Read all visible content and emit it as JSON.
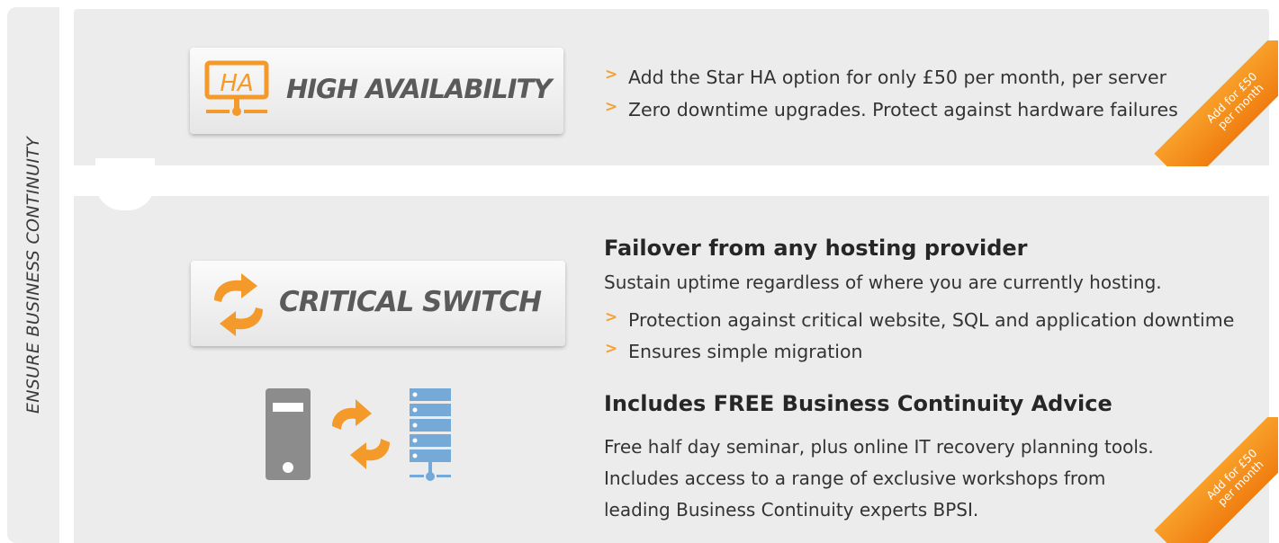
{
  "sidebar": {
    "label": "ENSURE BUSINESS CONTINUITY"
  },
  "ha": {
    "title": "HIGH AVAILABILITY",
    "icon_text": "HA",
    "bullets": [
      "Add the Star HA option for only £50 per month, per server",
      "Zero downtime upgrades. Protect against hardware failures"
    ],
    "ribbon_line1": "Add for £50",
    "ribbon_line2": "per month"
  },
  "critical": {
    "title": "CRITICAL SWITCH",
    "heading": "Failover from any hosting provider",
    "intro": "Sustain uptime regardless of where you are currently hosting.",
    "bullets": [
      "Protection against critical website, SQL and application downtime",
      "Ensures simple migration"
    ],
    "advice_heading": "Includes FREE Business Continuity Advice",
    "advice_lines": [
      "Free half day seminar, plus online IT recovery planning tools.",
      "Includes access to a range of exclusive workshops from",
      "leading Business Continuity experts BPSI."
    ],
    "ribbon_line1": "Add for £50",
    "ribbon_line2": "per month"
  },
  "colors": {
    "accent": "#f5a033",
    "panel": "#ececec",
    "server_grey": "#8a8a8a",
    "server_blue": "#6fa6d6"
  },
  "icons": [
    "ha-monitor-icon",
    "switch-arrows-icon",
    "grey-server-icon",
    "blue-server-rack-icon"
  ]
}
